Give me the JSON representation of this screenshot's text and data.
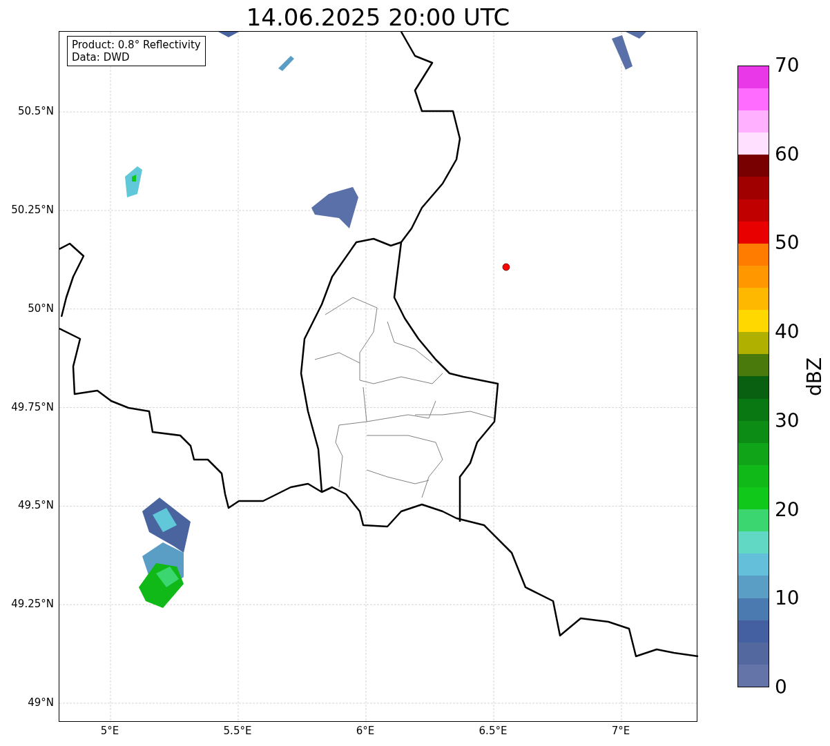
{
  "title": "14.06.2025 20:00 UTC",
  "legend": {
    "lines": [
      "Product: 0.8° Reflectivity",
      "Data: DWD"
    ]
  },
  "map": {
    "lat_ticks": [
      "50.5°N",
      "50.25°N",
      "50°N",
      "49.75°N",
      "49.5°N",
      "49.25°N",
      "49°N"
    ],
    "lon_ticks": [
      "5°E",
      "5.5°E",
      "6°E",
      "6.5°E",
      "7°E"
    ]
  },
  "colorbar": {
    "label": "dBZ",
    "ticks": [
      "70",
      "60",
      "50",
      "40",
      "30",
      "20",
      "10",
      "0"
    ],
    "segments": [
      {
        "color": "#6574a8"
      },
      {
        "color": "#5468a0"
      },
      {
        "color": "#4460a0"
      },
      {
        "color": "#4b7ab0"
      },
      {
        "color": "#5a9ec6"
      },
      {
        "color": "#64c0da"
      },
      {
        "color": "#60d8c4"
      },
      {
        "color": "#3cd670"
      },
      {
        "color": "#10c81a"
      },
      {
        "color": "#10b818"
      },
      {
        "color": "#10a418"
      },
      {
        "color": "#0c8c14"
      },
      {
        "color": "#0a7812"
      },
      {
        "color": "#086010"
      },
      {
        "color": "#4a7a0c"
      },
      {
        "color": "#b0b000"
      },
      {
        "color": "#ffd800"
      },
      {
        "color": "#ffb800"
      },
      {
        "color": "#ff9800"
      },
      {
        "color": "#ff7c00"
      },
      {
        "color": "#e80000"
      },
      {
        "color": "#c00000"
      },
      {
        "color": "#a00000"
      },
      {
        "color": "#780000"
      },
      {
        "color": "#ffe0ff"
      },
      {
        "color": "#ffb0ff"
      },
      {
        "color": "#ff6cff"
      },
      {
        "color": "#e838e8"
      }
    ]
  }
}
